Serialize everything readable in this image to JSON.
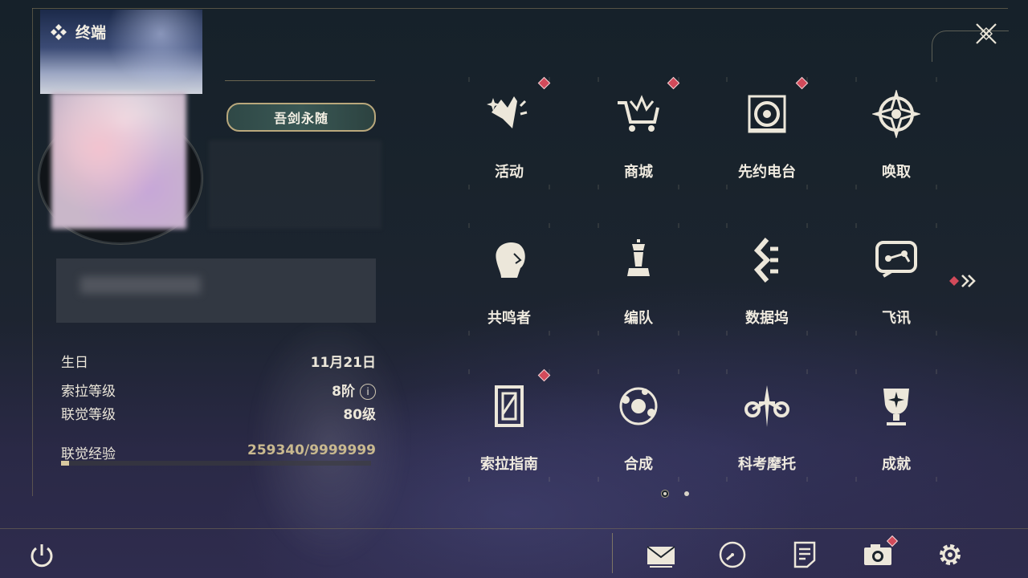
{
  "terminal": {
    "title": "终端"
  },
  "profile": {
    "title_badge": "吾剑永随",
    "stats": [
      {
        "label": "生日",
        "value": "11月21日"
      },
      {
        "label": "索拉等级",
        "value": "8阶"
      },
      {
        "label": "联觉等级",
        "value": "80级"
      }
    ],
    "exp": {
      "label": "联觉经验",
      "value": "259340/9999999",
      "fraction": 0.026
    }
  },
  "menu": {
    "items": [
      {
        "label": "活动",
        "icon": "activity-icon",
        "badge": true
      },
      {
        "label": "商城",
        "icon": "shop-cart-icon",
        "badge": true
      },
      {
        "label": "先约电台",
        "icon": "radio-icon",
        "badge": true
      },
      {
        "label": "唤取",
        "icon": "convene-icon",
        "badge": false
      },
      {
        "label": "共鸣者",
        "icon": "resonator-icon",
        "badge": false
      },
      {
        "label": "编队",
        "icon": "team-chess-icon",
        "badge": false
      },
      {
        "label": "数据坞",
        "icon": "data-bank-icon",
        "badge": false
      },
      {
        "label": "飞讯",
        "icon": "message-icon",
        "badge": false
      },
      {
        "label": "索拉指南",
        "icon": "guidebook-icon",
        "badge": true
      },
      {
        "label": "合成",
        "icon": "synthesis-icon",
        "badge": false
      },
      {
        "label": "科考摩托",
        "icon": "motorcycle-icon",
        "badge": false
      },
      {
        "label": "成就",
        "icon": "trophy-icon",
        "badge": false
      }
    ],
    "pages": 2,
    "current_page": 1
  },
  "bottom_bar": {
    "icons": [
      "mail-icon",
      "clock-icon",
      "notes-icon",
      "camera-icon",
      "settings-gear-icon"
    ],
    "camera_badge": true
  },
  "colors": {
    "accent_gold": "#c9b98f",
    "badge_red": "#d24a5a",
    "text": "#efeadf"
  }
}
